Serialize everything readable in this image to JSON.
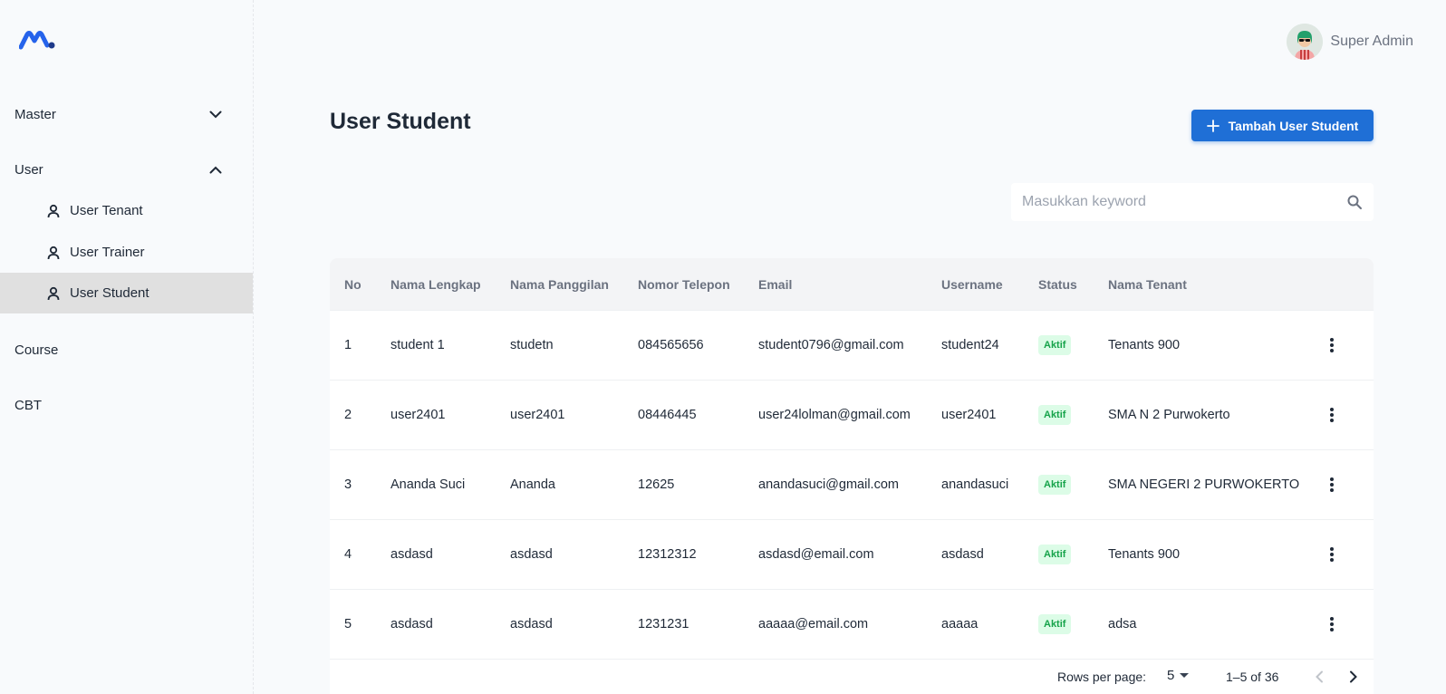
{
  "app": {
    "logo_icon": "brand-m-logo-icon",
    "accent_color": "#1f6fd6"
  },
  "header": {
    "user_name": "Super Admin",
    "avatar_icon": "avatar-icon"
  },
  "sidebar": {
    "groups": [
      {
        "label": "Master",
        "icon": "chevron-down-icon"
      },
      {
        "label": "User",
        "icon": "chevron-up-icon",
        "items": [
          {
            "label": "User Tenant",
            "icon": "person-icon"
          },
          {
            "label": "User Trainer",
            "icon": "person-icon"
          },
          {
            "label": "User Student",
            "icon": "person-icon",
            "active": true
          }
        ]
      },
      {
        "label": "Course"
      },
      {
        "label": "CBT"
      }
    ]
  },
  "main": {
    "title": "User Student",
    "add_button_label": "Tambah User Student",
    "search": {
      "placeholder": "Masukkan keyword",
      "value": ""
    },
    "table": {
      "columns": [
        "No",
        "Nama Lengkap",
        "Nama Panggilan",
        "Nomor Telepon",
        "Email",
        "Username",
        "Status",
        "Nama Tenant"
      ],
      "rows": [
        [
          "1",
          "student 1",
          "studetn",
          "084565656",
          "student0796@gmail.com",
          "student24",
          "Aktif",
          "Tenants 900"
        ],
        [
          "2",
          "user2401",
          "user2401",
          "08446445",
          "user24lolman@gmail.com",
          "user2401",
          "Aktif",
          "SMA N 2 Purwokerto"
        ],
        [
          "3",
          "Ananda Suci",
          "Ananda",
          "12625",
          "anandasuci@gmail.com",
          "anandasuci",
          "Aktif",
          "SMA NEGERI 2 PURWOKERTO"
        ],
        [
          "4",
          "asdasd",
          "asdasd",
          "12312312",
          "asdasd@email.com",
          "asdasd",
          "Aktif",
          "Tenants 900"
        ],
        [
          "5",
          "asdasd",
          "asdasd",
          "1231231",
          "aaaaa@email.com",
          "aaaaa",
          "Aktif",
          "adsa"
        ]
      ]
    },
    "pagination": {
      "rows_per_page_label": "Rows per page:",
      "rows_per_page": "5",
      "range": "1–5 of 36"
    }
  },
  "colors": {
    "status_active_bg": "#dcfce7",
    "status_active_text": "#16a34a"
  }
}
